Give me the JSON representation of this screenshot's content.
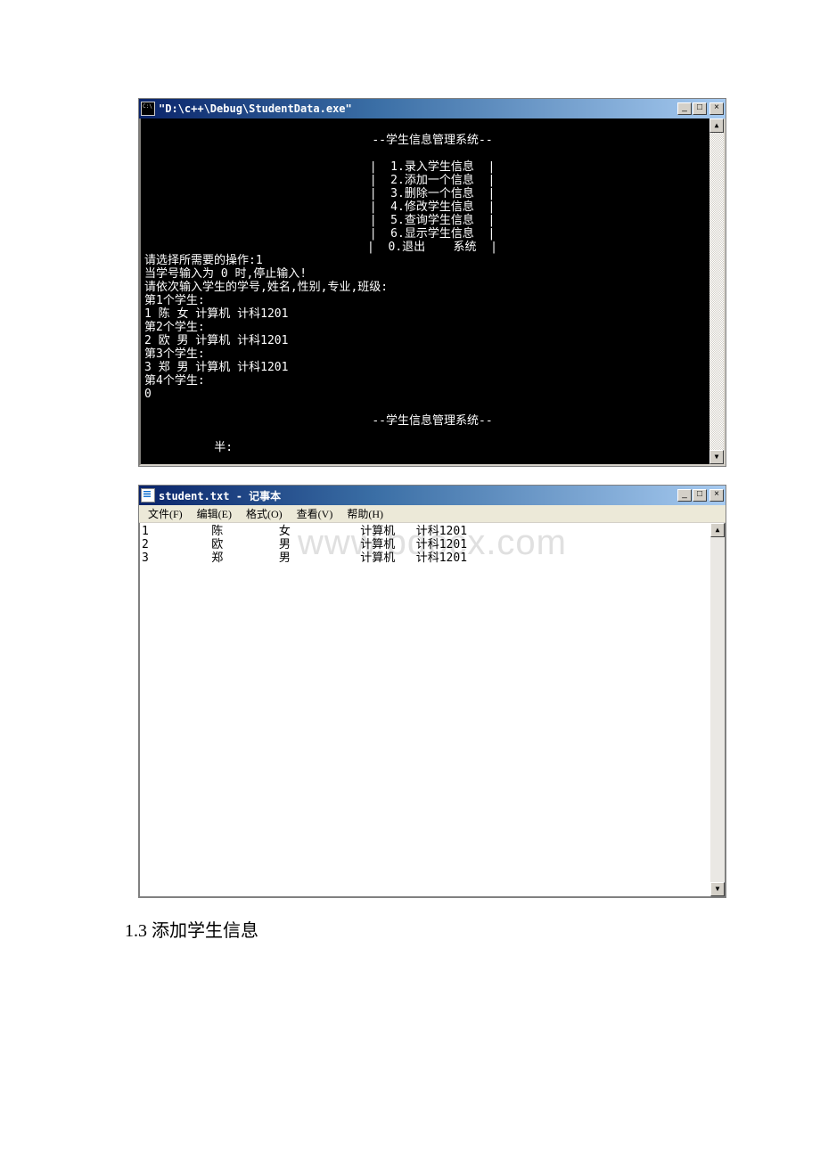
{
  "console": {
    "title": "\"D:\\c++\\Debug\\StudentData.exe\"",
    "header": "--学生信息管理系统--",
    "menu": [
      "1.录入学生信息",
      "2.添加一个信息",
      "3.删除一个信息",
      "4.修改学生信息",
      "5.查询学生信息",
      "6.显示学生信息",
      "0.退出    系统"
    ],
    "dash": "|",
    "prompt": "请选择所需要的操作:1",
    "stop_hint": "当学号输入为 0 时,停止输入!",
    "input_hint": "请依次输入学生的学号,姓名,性别,专业,班级:",
    "entries": [
      {
        "label": "第1个学生:",
        "data": "1 陈 女 计算机 计科1201"
      },
      {
        "label": "第2个学生:",
        "data": "2 欧 男 计算机 计科1201"
      },
      {
        "label": "第3个学生:",
        "data": "3 郑 男 计算机 计科1201"
      },
      {
        "label": "第4个学生:",
        "data": "0"
      }
    ],
    "footer": "--学生信息管理系统--",
    "half": "半:"
  },
  "notepad": {
    "title": "student.txt - 记事本",
    "menus": {
      "file": "文件(F)",
      "edit": "编辑(E)",
      "format": "格式(O)",
      "view": "查看(V)",
      "help": "帮助(H)"
    },
    "rows": [
      {
        "id": "1",
        "name": "陈",
        "gender": "女",
        "major": "计算机",
        "class": "计科1201"
      },
      {
        "id": "2",
        "name": "欧",
        "gender": "男",
        "major": "计算机",
        "class": "计科1201"
      },
      {
        "id": "3",
        "name": "郑",
        "gender": "男",
        "major": "计算机",
        "class": "计科1201"
      }
    ]
  },
  "watermark": "www.bdocx.com",
  "caption": "1.3 添加学生信息"
}
